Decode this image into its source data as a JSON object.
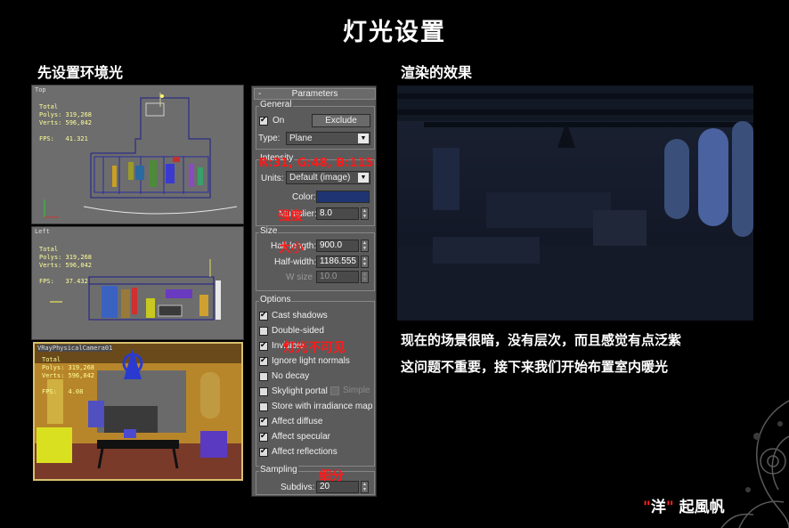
{
  "title": "灯光设置",
  "left_heading": "先设置环境光",
  "right_heading": "渲染的效果",
  "viewports": {
    "top": {
      "label": "Top",
      "stats": "Total\nPolys: 319,268\nVerts: 596,042\n\nFPS:   41.321"
    },
    "left": {
      "label": "Left",
      "stats": "Total\nPolys: 319,268\nVerts: 596,042\n\nFPS:   37.432"
    },
    "camera": {
      "label": "VRayPhysicalCamera01",
      "stats": "Total\nPolys: 319,268\nVerts: 596,042\n\nFPS:   4.08"
    }
  },
  "params": {
    "rollout_title": "Parameters",
    "rollout_toggle": "-",
    "general": {
      "label": "General",
      "on_label": "On",
      "exclude_label": "Exclude",
      "type_label": "Type:",
      "type_value": "Plane"
    },
    "intensity": {
      "label": "Intensity",
      "units_label": "Units:",
      "units_value": "Default (image)",
      "color_label": "Color:",
      "color_hex": "#1f3573",
      "multiplier_label": "Multiplier:",
      "multiplier_value": "8.0"
    },
    "size": {
      "label": "Size",
      "half_length_label": "Half-length:",
      "half_length_value": "900.0",
      "half_width_label": "Half-width:",
      "half_width_value": "1186.555",
      "w_size_label": "W size",
      "w_size_value": "10.0"
    },
    "options": {
      "label": "Options",
      "items": [
        {
          "label": "Cast shadows",
          "checked": true
        },
        {
          "label": "Double-sided",
          "checked": false
        },
        {
          "label": "Invisible",
          "checked": true
        },
        {
          "label": "Ignore light normals",
          "checked": true
        },
        {
          "label": "No decay",
          "checked": false
        },
        {
          "label": "Skylight portal",
          "checked": false
        },
        {
          "label": "Store with irradiance map",
          "checked": false
        },
        {
          "label": "Affect diffuse",
          "checked": true
        },
        {
          "label": "Affect specular",
          "checked": true
        },
        {
          "label": "Affect reflections",
          "checked": true
        }
      ],
      "simple_label": "Simple"
    },
    "sampling": {
      "label": "Sampling",
      "subdivs_label": "Subdivs:",
      "subdivs_value": "20"
    }
  },
  "annotations": {
    "rgb": "R:31, G:48, B:115",
    "multiplier": "强度",
    "size": "大小",
    "invisible": "灯光不可见",
    "subdivs": "细分"
  },
  "description": {
    "line1": "现在的场景很暗，没有层次，而且感觉有点泛紫",
    "line2": "这问题不重要，接下来我们开始布置室内暖光"
  },
  "author": {
    "quote_open": "\"",
    "name": "洋",
    "quote_close": "\"",
    "suffix": "起風帆"
  }
}
